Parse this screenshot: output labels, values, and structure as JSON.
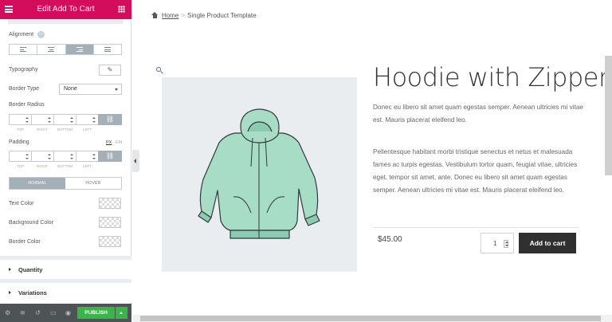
{
  "editor": {
    "title": "Edit Add To Cart",
    "menu_icon": "hamburger-icon",
    "widgets_icon": "grid-icon"
  },
  "style": {
    "alignment_label": "Alignment",
    "alignment_options": [
      "left",
      "center",
      "right",
      "justify"
    ],
    "alignment_selected": "right",
    "typography_label": "Typography",
    "border_type_label": "Border Type",
    "border_type_value": "None",
    "border_radius_label": "Border Radius",
    "dim_labels": [
      "TOP",
      "RIGHT",
      "BOTTOM",
      "LEFT"
    ],
    "padding_label": "Padding",
    "unit_px": "PX",
    "unit_em": "EM",
    "tab_normal": "NORMAL",
    "tab_hover": "HOVER",
    "text_color_label": "Text Color",
    "background_color_label": "Background Color",
    "border_color_label": "Border Color"
  },
  "sections": {
    "quantity": "Quantity",
    "variations": "Variations"
  },
  "footer": {
    "publish_label": "PUBLISH",
    "icons": [
      "settings-icon",
      "layers-icon",
      "history-icon",
      "responsive-icon",
      "preview-icon"
    ]
  },
  "breadcrumb": {
    "home": "Home",
    "separator": ">",
    "current": "Single Product Template"
  },
  "product": {
    "title": "Hoodie with Zipper",
    "short_desc": "Donec eu libero sit amet quam egestas semper. Aenean ultricies mi vitae est. Mauris placerat eleifend leo.",
    "long_desc": "Pellentesque habitant morbi tristique senectus et netus et malesuada fames ac turpis egestas. Vestibulum tortor quam, feugiat vitae, ultricies eget, tempor sit amet, ante. Donec eu libero sit amet quam egestas semper. Aenean ultricies mi vitae est. Mauris placerat eleifend leo.",
    "price": "$45.00",
    "quantity": "1",
    "add_to_cart": "Add to cart",
    "image_alt_icon": "hoodie-image"
  },
  "colors": {
    "editor_accent": "#d30c5c",
    "publish_green": "#39b54a",
    "button_dark": "#303030",
    "hoodie": "#a7dcc7"
  }
}
